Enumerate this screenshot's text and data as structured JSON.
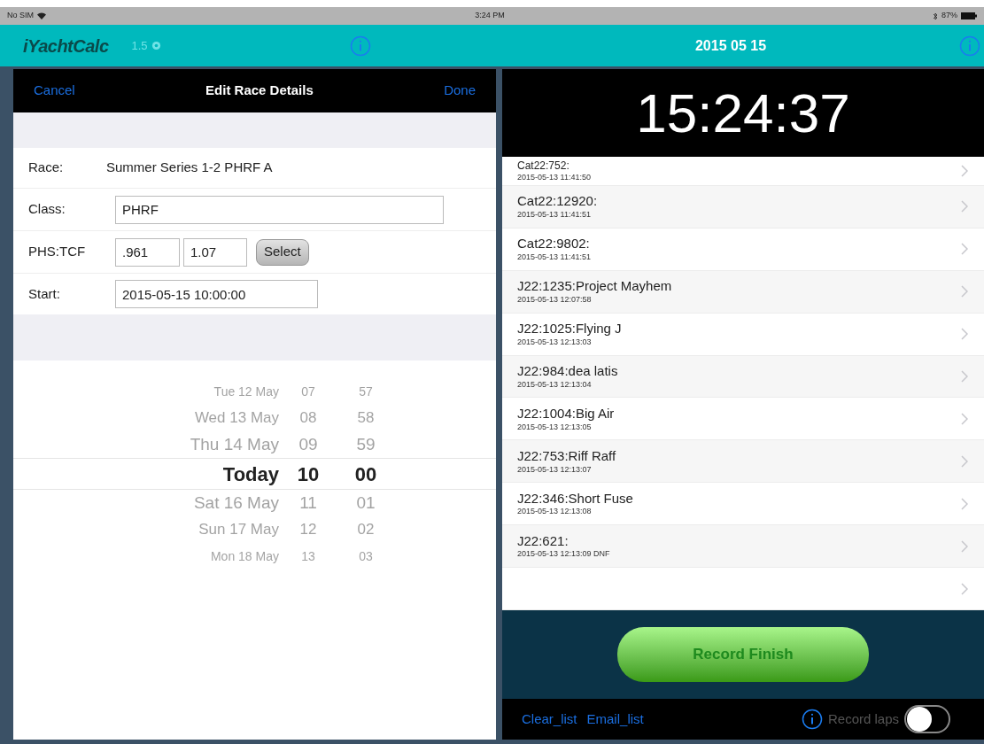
{
  "status_bar": {
    "carrier": "No SIM",
    "time": "3:24 PM",
    "battery": "87%"
  },
  "app_bar": {
    "title": "iYachtCalc",
    "version": "1.5",
    "date": "2015 05 15"
  },
  "edit_panel": {
    "cancel": "Cancel",
    "title": "Edit Race Details",
    "done": "Done",
    "race": {
      "label": "Race:",
      "value": "Summer Series 1-2 PHRF A"
    },
    "class": {
      "label": "Class:",
      "value": "PHRF"
    },
    "phs_tcf": {
      "label": "PHS:TCF",
      "phs": ".961",
      "tcf": "1.07",
      "button": "Select"
    },
    "start": {
      "label": "Start:",
      "value": "2015-05-15 10:00:00"
    },
    "picker": [
      {
        "day": "Tue 12 May",
        "hour": "07",
        "minute": "57",
        "selected": false
      },
      {
        "day": "Wed 13 May",
        "hour": "08",
        "minute": "58",
        "selected": false
      },
      {
        "day": "Thu 14 May",
        "hour": "09",
        "minute": "59",
        "selected": false
      },
      {
        "day": "Today",
        "hour": "10",
        "minute": "00",
        "selected": true
      },
      {
        "day": "Sat 16 May",
        "hour": "11",
        "minute": "01",
        "selected": false
      },
      {
        "day": "Sun 17 May",
        "hour": "12",
        "minute": "02",
        "selected": false
      },
      {
        "day": "Mon 18 May",
        "hour": "13",
        "minute": "03",
        "selected": false
      }
    ]
  },
  "finish_panel": {
    "clock": "15:24:37",
    "finishes": [
      {
        "kind": "entry",
        "name": "Cat22:752:",
        "time": "2015-05-13 11:41:50"
      },
      {
        "kind": "entry",
        "name": "Cat22:12920:",
        "time": "2015-05-13 11:41:51"
      },
      {
        "kind": "entry",
        "name": "Cat22:9802:",
        "time": "2015-05-13 11:41:51"
      },
      {
        "kind": "entry",
        "name": "J22:1235:Project Mayhem",
        "time": "2015-05-13 12:07:58"
      },
      {
        "kind": "entry",
        "name": "J22:1025:Flying J",
        "time": "2015-05-13 12:13:03"
      },
      {
        "kind": "entry",
        "name": "J22:984:dea latis",
        "time": "2015-05-13 12:13:04"
      },
      {
        "kind": "entry",
        "name": "J22:1004:Big Air",
        "time": "2015-05-13 12:13:05"
      },
      {
        "kind": "entry",
        "name": "J22:753:Riff Raff",
        "time": "2015-05-13 12:13:07"
      },
      {
        "kind": "entry",
        "name": "J22:346:Short Fuse",
        "time": "2015-05-13 12:13:08"
      },
      {
        "kind": "entry",
        "name": "J22:621:",
        "time": "2015-05-13 12:13:09 DNF"
      },
      {
        "kind": "blank"
      }
    ],
    "record_button": "Record Finish",
    "clear_list": "Clear_list",
    "email_list": "Email_list",
    "record_laps": {
      "label": "Record laps",
      "on": false
    }
  }
}
